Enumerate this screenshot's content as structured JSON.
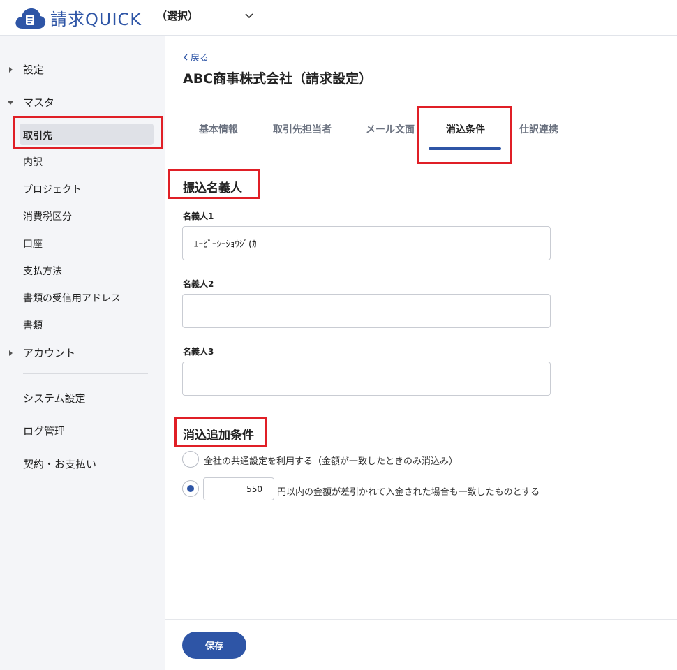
{
  "header": {
    "logo_text": "請求QUICK",
    "company_select": "（選択）"
  },
  "sidebar": {
    "groups": [
      {
        "label": "設定",
        "expanded": false
      },
      {
        "label": "マスタ",
        "expanded": true
      },
      {
        "label": "アカウント",
        "expanded": false
      }
    ],
    "master_items": [
      "取引先",
      "内訳",
      "プロジェクト",
      "消費税区分",
      "口座",
      "支払方法",
      "書類の受信用アドレス",
      "書類"
    ],
    "active_item": "取引先",
    "links": [
      "システム設定",
      "ログ管理",
      "契約・お支払い"
    ]
  },
  "main": {
    "back_label": "戻る",
    "title": "ABC商事株式会社（請求設定）",
    "tabs": [
      "基本情報",
      "取引先担当者",
      "メール文面",
      "消込条件",
      "仕訳連携"
    ],
    "active_tab": "消込条件",
    "section1": {
      "title": "振込名義人",
      "fields": [
        {
          "label": "名義人1",
          "value": "ｴｰﾋﾞｰｼｰｼｮｳｼﾞ(ｶ"
        },
        {
          "label": "名義人2",
          "value": ""
        },
        {
          "label": "名義人3",
          "value": ""
        }
      ]
    },
    "section2": {
      "title": "消込追加条件",
      "option1": "全社の共通設定を利用する（金額が一致したときのみ消込み）",
      "option2_amount": "550",
      "option2_suffix": "円以内の金額が差引かれて入金された場合も一致したものとする",
      "selected_option": 2
    }
  },
  "footer": {
    "save_label": "保存"
  },
  "colors": {
    "accent": "#2e55a6",
    "highlight": "#e01f26",
    "sidebar_bg": "#f4f5f8"
  }
}
